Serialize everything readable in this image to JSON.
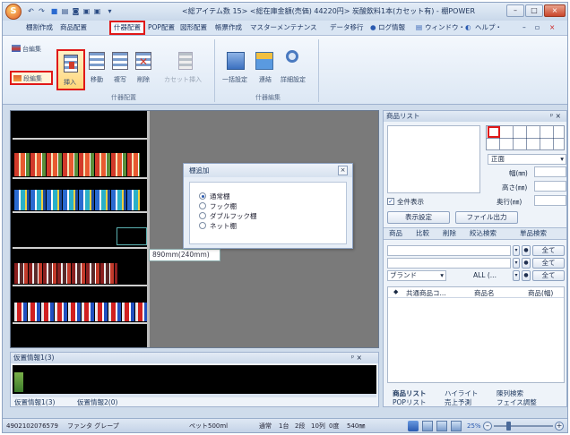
{
  "window": {
    "title": "<総アイテム数 15> <総在庫金額(売価) 44220円> 炭酸飲料1本(カセット有) - 棚POWER",
    "min": "–",
    "max": "□",
    "close": "×"
  },
  "quick_access": [
    "↶",
    "↷",
    "■",
    "▤",
    "◙",
    "▣",
    "▣",
    "▾"
  ],
  "menu_tabs": [
    "棚割作成",
    "商品配置",
    "什器配置",
    "POP配置",
    "図形配置",
    "帳票作成",
    "マスターメンテナンス",
    "データ移行"
  ],
  "menu_right": {
    "login": "ログ情報",
    "window": "ウィンドウ・",
    "help": "ヘルプ・",
    "ctrl_min": "–",
    "ctrl_max": "▫",
    "ctrl_close": "×"
  },
  "ribbon": {
    "stand_edit": "台編集",
    "shelf_edit": "段編集",
    "insert": "挿入",
    "move": "移動",
    "copy": "複写",
    "delete": "削除",
    "cassette": "カセット挿入",
    "group1": "什器配置",
    "batch_setting": "一括設定",
    "link": "連結",
    "detail_setting": "詳細設定",
    "group2": "什器編集"
  },
  "dialog": {
    "title": "棚追加",
    "options": [
      "通常棚",
      "フック棚",
      "ダブルフック棚",
      "ネット棚"
    ],
    "selected": 0,
    "close": "×"
  },
  "dim_label": "890mm(240mm)",
  "product_list": {
    "header": "商品リスト",
    "pin": "ᵖ ×",
    "face": "正面",
    "width_label": "幅(㎜)",
    "height_label": "高さ(㎜)",
    "depth_label": "奥行(㎜)",
    "show_all": "全件表示",
    "show_settings": "表示設定",
    "file_output": "ファイル出力",
    "tabs": [
      "商品",
      "比較",
      "削除",
      "絞込検索",
      "単品検索"
    ],
    "all_btn": "全て",
    "brand": "ブランド",
    "all_filter": "ALL (...",
    "columns": [
      "◆",
      "共通商品コ...",
      "商品名",
      "商品(幅)"
    ],
    "bottom_tabs_row1": [
      "商品リスト",
      "ハイライト",
      "陳列検索"
    ],
    "bottom_tabs_row2": [
      "POPリスト",
      "売上予測",
      "フェイス調整"
    ]
  },
  "bottom_panel": {
    "header": "仮置情報1(3)",
    "pin": "ᵖ ×",
    "tabs": [
      "仮置情報1(3)",
      "仮置情報2(0)"
    ]
  },
  "status": {
    "code": "4902102076579",
    "product": "ファンタ グレープ",
    "size": "ペット500ml",
    "type": "通常",
    "stand": "1台",
    "shelf": "2段",
    "col": "10列",
    "pos": "0度",
    "mm": "540㎜",
    "zoom": "25%"
  },
  "colors": {
    "accent_red": "#e01818",
    "shelf_bg": "#000000",
    "work_bg": "#7a7a7a"
  }
}
